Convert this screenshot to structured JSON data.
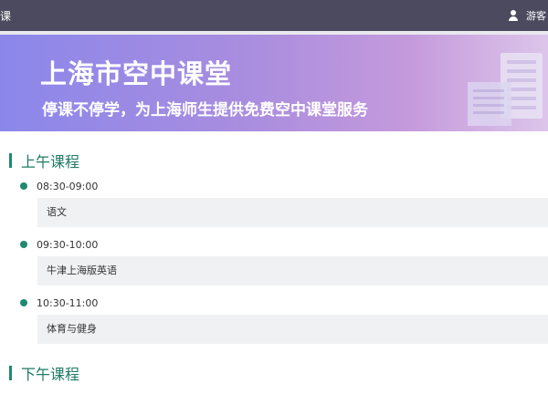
{
  "header": {
    "app_title": "课",
    "user_label": "游客",
    "user_icon": "user-icon"
  },
  "banner": {
    "title": "上海市空中课堂",
    "subtitle": "停课不停学，为上海师生提供免费空中课堂服务"
  },
  "morning": {
    "title": "上午课程",
    "slots": [
      {
        "time": "08:30-09:00",
        "course": "语文"
      },
      {
        "time": "09:30-10:00",
        "course": "牛津上海版英语"
      },
      {
        "time": "10:30-11:00",
        "course": "体育与健身"
      }
    ]
  },
  "afternoon": {
    "title": "下午课程"
  },
  "colors": {
    "topbar": "#4b4a5e",
    "accent": "#1f8a6f",
    "course_bg": "#f0f1f3"
  }
}
